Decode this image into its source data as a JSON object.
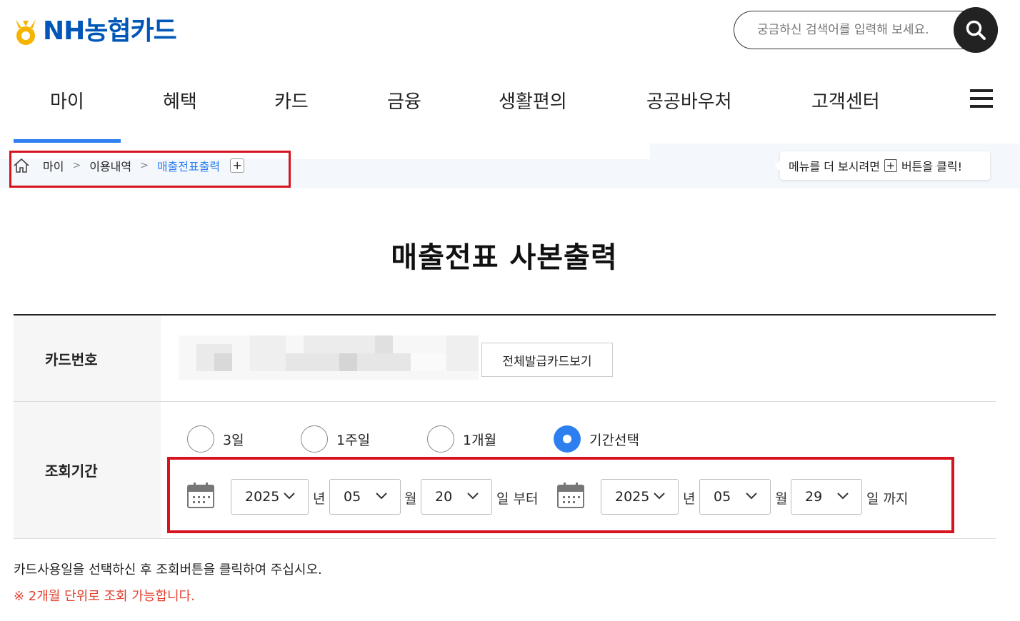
{
  "header": {
    "logo_text": "NH농협카드",
    "search_placeholder": "궁금하신 검색어를 입력해 보세요."
  },
  "gnb": {
    "items": [
      {
        "label": "마이"
      },
      {
        "label": "혜택"
      },
      {
        "label": "카드"
      },
      {
        "label": "금융"
      },
      {
        "label": "생활편의"
      },
      {
        "label": "공공바우처"
      },
      {
        "label": "고객센터"
      }
    ],
    "active_index": 0
  },
  "breadcrumb": {
    "items": [
      "마이",
      "이용내역",
      "매출전표출력"
    ],
    "separator": ">",
    "plus": "+"
  },
  "tooltip": {
    "before": "메뉴를 더 보시려면",
    "plus": "+",
    "after": "버튼을 클릭!"
  },
  "page": {
    "title": "매출전표 사본출력"
  },
  "form": {
    "card_label": "카드번호",
    "all_cards_button": "전체발급카드보기",
    "period_label": "조회기간",
    "period_options": [
      {
        "label": "3일",
        "selected": false
      },
      {
        "label": "1주일",
        "selected": false
      },
      {
        "label": "1개월",
        "selected": false
      },
      {
        "label": "기간선택",
        "selected": true
      }
    ],
    "start": {
      "year": "2025",
      "month": "05",
      "day": "20"
    },
    "end": {
      "year": "2025",
      "month": "05",
      "day": "29"
    },
    "units": {
      "year": "년",
      "month": "월",
      "day_from": "일 부터",
      "day_to": "일 까지"
    }
  },
  "notices": {
    "line1": "카드사용일을 선택하신 후 조회버튼을 클릭하여 주십시오.",
    "line2": "※ 2개월 단위로 조회 가능합니다."
  },
  "colors": {
    "brand_blue": "#0057b8",
    "accent_blue": "#2d7ff0",
    "highlight_red": "#d6131e",
    "notice_red": "#e2402f",
    "logo_yellow": "#f5b400"
  },
  "icons": [
    "home-icon",
    "search-icon",
    "hamburger-menu-icon",
    "calendar-icon",
    "chevron-down-icon"
  ]
}
